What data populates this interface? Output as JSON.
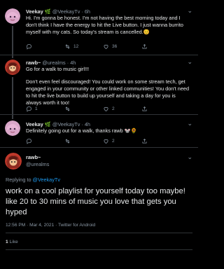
{
  "tweets": [
    {
      "name": "Veekay",
      "badge": "🌿",
      "handle": "@VeekayTv",
      "time": "6h",
      "text": "Hi. I'm gonna be honest. I'm not having the best morning today and I don't think I have the energy to hit the Live button. I just wanna burrito myself with my cats. So today's stream is cancelled.",
      "emoji": "😊",
      "replies": "",
      "retweets": "12",
      "likes": "36"
    },
    {
      "name": "rawb~",
      "handle": "@urealms",
      "time": "4h",
      "text1": "Go for a walk to music girl!!!",
      "text2": "Don't even feel discouraged! You could work on some stream tech, get engaged in your community or other linked communities! You don't need to hit the live button to build up yourself and taking a day for you is always worth it too!",
      "replies": "1",
      "retweets": "",
      "likes": "2"
    },
    {
      "name": "Veekay",
      "badge": "🌿",
      "handle": "@VeekayTv",
      "time": "4h",
      "text": "Definitely going out for a walk, thanks rawb",
      "emoji": "🐭🌻",
      "replies": "",
      "retweets": "",
      "likes": "2"
    }
  ],
  "main": {
    "name": "rawb~",
    "handle": "@urealms",
    "reply_prefix": "Replying to",
    "reply_target": "@VeekayTv",
    "text": "work on a cool playlist for yourself today too maybe! like 20 to 30 mins of music you love that gets you hyped",
    "timestamp": "12:56 PM · Mar 4, 2021 · Twitter for Android",
    "like_count": "1",
    "like_label": "Like"
  },
  "icons": {
    "reply": "reply-icon",
    "retweet": "retweet-icon",
    "like": "heart-icon",
    "share": "share-icon",
    "more": "more-icon"
  },
  "colors": {
    "background": "#000000",
    "link": "#1d9bf0",
    "muted": "#8b98a5"
  }
}
